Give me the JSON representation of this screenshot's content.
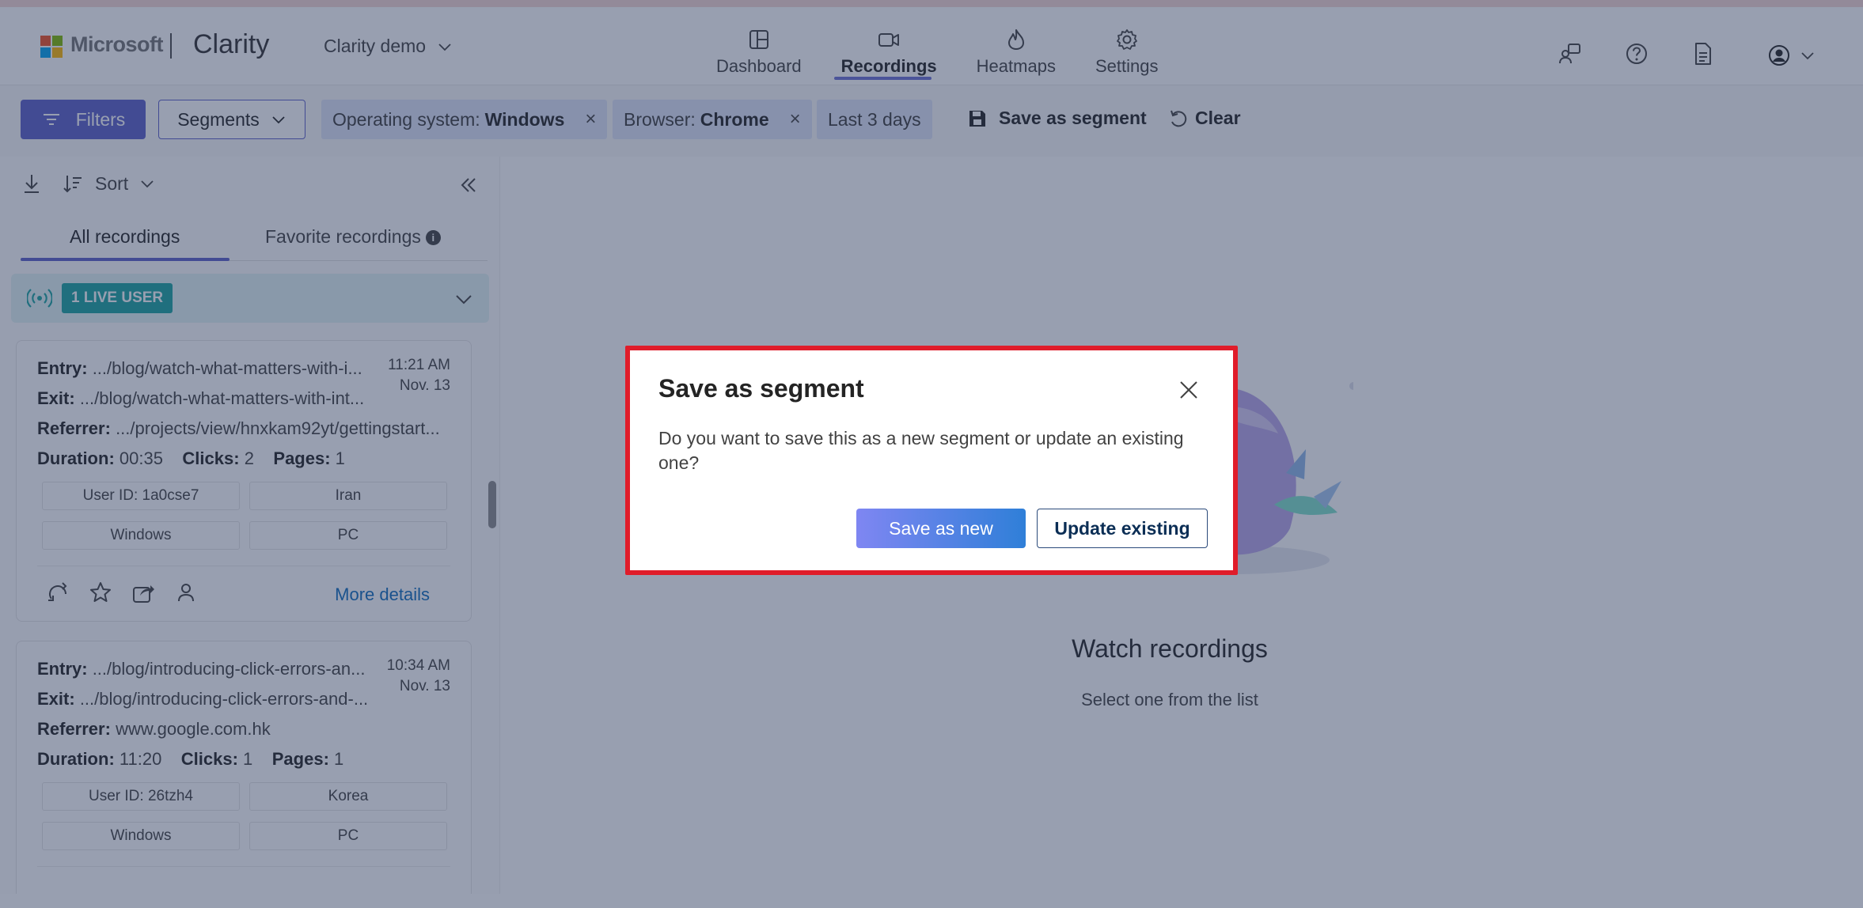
{
  "header": {
    "brand": "Microsoft",
    "product": "Clarity",
    "project": "Clarity demo",
    "nav": [
      {
        "label": "Dashboard",
        "icon": "dashboard-icon"
      },
      {
        "label": "Recordings",
        "icon": "video-icon",
        "active": true
      },
      {
        "label": "Heatmaps",
        "icon": "flame-icon"
      },
      {
        "label": "Settings",
        "icon": "gear-icon"
      }
    ]
  },
  "filterbar": {
    "filters_label": "Filters",
    "segments_label": "Segments",
    "chip_os_key": "Operating system:",
    "chip_os_value": "Windows",
    "chip_browser_key": "Browser:",
    "chip_browser_value": "Chrome",
    "chip_range": "Last 3 days",
    "save_segment": "Save as segment",
    "clear": "Clear",
    "remove_glyph": "×"
  },
  "leftpanel": {
    "sort_label": "Sort",
    "tab_all": "All recordings",
    "tab_fav": "Favorite recordings",
    "info_glyph": "i",
    "live_badge": "1 LIVE USER",
    "cards": [
      {
        "entry_label": "Entry:",
        "entry": ".../blog/watch-what-matters-with-i...",
        "exit_label": "Exit:",
        "exit": ".../blog/watch-what-matters-with-int...",
        "referrer_label": "Referrer:",
        "referrer": ".../projects/view/hnxkam92yt/gettingstart...",
        "duration_label": "Duration:",
        "duration": "00:35",
        "clicks_label": "Clicks:",
        "clicks": "2",
        "pages_label": "Pages:",
        "pages": "1",
        "time": "11:21 AM",
        "date": "Nov. 13",
        "user_id": "User ID: 1a0cse7",
        "country": "Iran",
        "os": "Windows",
        "device": "PC",
        "more": "More details"
      },
      {
        "entry_label": "Entry:",
        "entry": ".../blog/introducing-click-errors-an...",
        "exit_label": "Exit:",
        "exit": ".../blog/introducing-click-errors-and-...",
        "referrer_label": "Referrer:",
        "referrer": "www.google.com.hk",
        "duration_label": "Duration:",
        "duration": "11:20",
        "clicks_label": "Clicks:",
        "clicks": "1",
        "pages_label": "Pages:",
        "pages": "1",
        "time": "10:34 AM",
        "date": "Nov. 13",
        "user_id": "User ID: 26tzh4",
        "country": "Korea",
        "os": "Windows",
        "device": "PC"
      }
    ]
  },
  "main": {
    "title": "Watch recordings",
    "subtitle": "Select one from the list"
  },
  "dialog": {
    "title": "Save as segment",
    "body": "Do you want to save this as a new segment or update an existing one?",
    "primary": "Save as new",
    "secondary": "Update existing"
  },
  "colors": {
    "accent": "#5b5fc7",
    "live": "#1aa3a0",
    "dialog_border": "#e01c2a",
    "link": "#0f6cbd"
  }
}
